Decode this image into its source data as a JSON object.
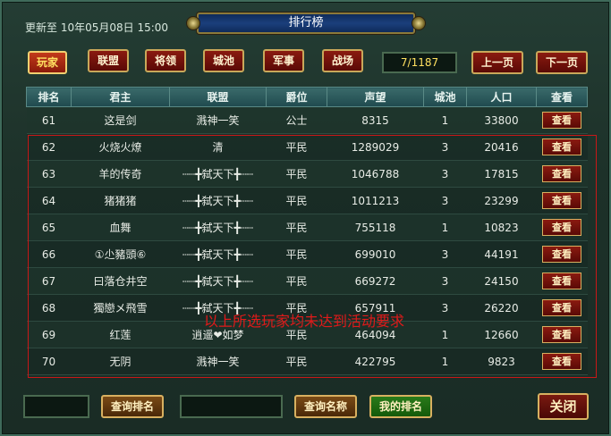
{
  "header": {
    "update_text": "更新至 10年05月08日 15:00",
    "title": "排行榜"
  },
  "tabs": [
    {
      "label": "玩家",
      "active": true
    },
    {
      "label": "联盟",
      "active": false
    },
    {
      "label": "将领",
      "active": false
    },
    {
      "label": "城池",
      "active": false
    },
    {
      "label": "军事",
      "active": false
    },
    {
      "label": "战场",
      "active": false
    }
  ],
  "pagination": {
    "page_indicator": "7/1187",
    "prev_label": "上一页",
    "next_label": "下一页"
  },
  "table": {
    "columns": [
      "排名",
      "君主",
      "联盟",
      "爵位",
      "声望",
      "城池",
      "人口",
      "查看"
    ],
    "view_label": "查看",
    "rows": [
      {
        "rank": "61",
        "lord": "这是剑",
        "alliance": "溅神一笑",
        "title": "公士",
        "prestige": "8315",
        "cities": "1",
        "population": "33800"
      },
      {
        "rank": "62",
        "lord": "火烧火燎",
        "alliance": "清",
        "title": "平民",
        "prestige": "1289029",
        "cities": "3",
        "population": "20416"
      },
      {
        "rank": "63",
        "lord": "羊的传奇",
        "alliance": "┄┄╋弑天下╋┄┄",
        "title": "平民",
        "prestige": "1046788",
        "cities": "3",
        "population": "17815"
      },
      {
        "rank": "64",
        "lord": "猪猪猪",
        "alliance": "┄┄╋弑天下╋┄┄",
        "title": "平民",
        "prestige": "1011213",
        "cities": "3",
        "population": "23299"
      },
      {
        "rank": "65",
        "lord": "血舞",
        "alliance": "┄┄╋弑天下╋┄┄",
        "title": "平民",
        "prestige": "755118",
        "cities": "1",
        "population": "10823"
      },
      {
        "rank": "66",
        "lord": "①尐豬頭⑥",
        "alliance": "┄┄╋弑天下╋┄┄",
        "title": "平民",
        "prestige": "699010",
        "cities": "3",
        "population": "44191"
      },
      {
        "rank": "67",
        "lord": "曰落仓井空",
        "alliance": "┄┄╋弑天下╋┄┄",
        "title": "平民",
        "prestige": "669272",
        "cities": "3",
        "population": "24150"
      },
      {
        "rank": "68",
        "lord": "獨戀メ飛雪",
        "alliance": "┄┄╋弑天下╋┄┄",
        "title": "平民",
        "prestige": "657911",
        "cities": "3",
        "population": "26220"
      },
      {
        "rank": "69",
        "lord": "红莲",
        "alliance": "逍遥❤如梦",
        "title": "平民",
        "prestige": "464094",
        "cities": "1",
        "population": "12660"
      },
      {
        "rank": "70",
        "lord": "无阴",
        "alliance": "溅神一笑",
        "title": "平民",
        "prestige": "422795",
        "cities": "1",
        "population": "9823"
      }
    ]
  },
  "annotation": {
    "notice_text": "以上所选玩家均未达到活动要求",
    "color": "#e01a1a"
  },
  "footer": {
    "query_rank_label": "查询排名",
    "query_name_label": "查询名称",
    "my_rank_label": "我的排名",
    "close_label": "关闭"
  }
}
